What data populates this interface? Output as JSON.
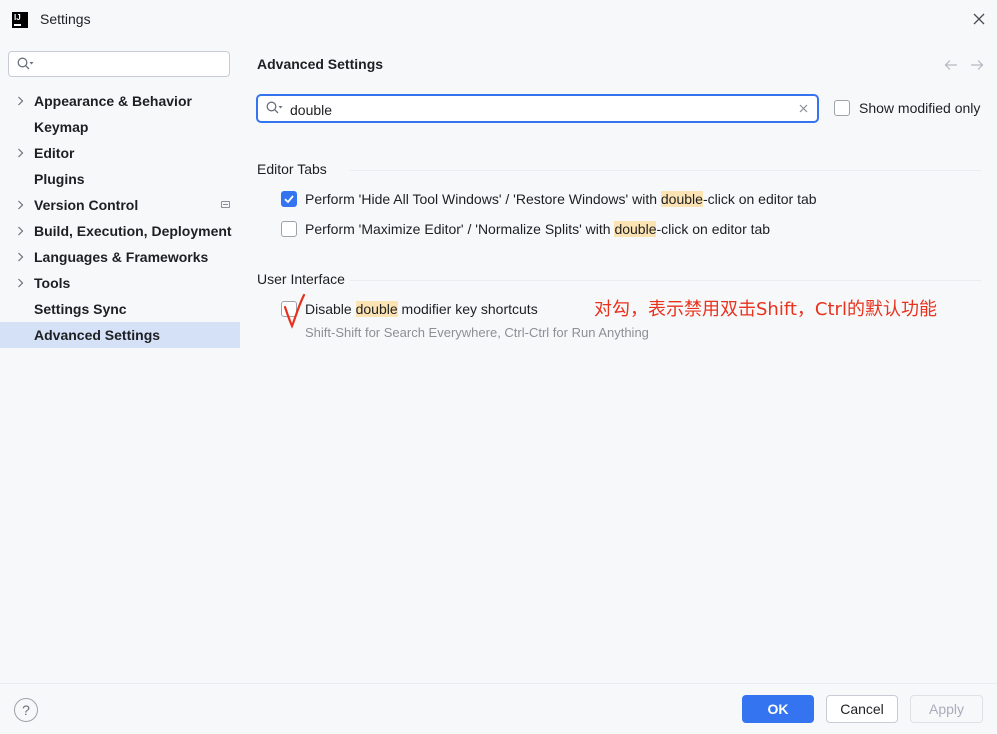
{
  "window": {
    "title": "Settings",
    "logo_text": "IJ"
  },
  "sidebar": {
    "search": {
      "value": "",
      "placeholder": ""
    },
    "items": [
      {
        "label": "Appearance & Behavior",
        "expandable": true
      },
      {
        "label": "Keymap",
        "expandable": false
      },
      {
        "label": "Editor",
        "expandable": true
      },
      {
        "label": "Plugins",
        "expandable": false
      },
      {
        "label": "Version Control",
        "expandable": true,
        "project_icon": true
      },
      {
        "label": "Build, Execution, Deployment",
        "expandable": true
      },
      {
        "label": "Languages & Frameworks",
        "expandable": true
      },
      {
        "label": "Tools",
        "expandable": true
      },
      {
        "label": "Settings Sync",
        "expandable": false
      },
      {
        "label": "Advanced Settings",
        "expandable": false,
        "selected": true
      }
    ]
  },
  "main": {
    "title": "Advanced Settings",
    "search": {
      "value": "double"
    },
    "show_modified": {
      "label": "Show modified only",
      "checked": false
    },
    "groups": {
      "editor_tabs": {
        "title": "Editor Tabs",
        "options": [
          {
            "pre": "Perform 'Hide All Tool Windows' / 'Restore Windows' with ",
            "match": "double",
            "post": "-click on editor tab",
            "checked": true
          },
          {
            "pre": "Perform 'Maximize Editor' / 'Normalize Splits' with ",
            "match": "double",
            "post": "-click on editor tab",
            "checked": false
          }
        ]
      },
      "user_interface": {
        "title": "User Interface",
        "options": [
          {
            "pre": "Disable ",
            "match": "double",
            "post": " modifier key shortcuts",
            "checked": false,
            "hint": "Shift-Shift for Search Everywhere, Ctrl-Ctrl for Run Anything"
          }
        ]
      }
    },
    "annotation": "对勾，表示禁用双击Shift，Ctrl的默认功能"
  },
  "footer": {
    "help_label": "?",
    "ok_label": "OK",
    "cancel_label": "Cancel",
    "apply_label": "Apply"
  },
  "colors": {
    "accent": "#3574f0",
    "selection": "#d5e1f7",
    "match_highlight": "#fbe3b3",
    "annotation": "#e8321d"
  }
}
